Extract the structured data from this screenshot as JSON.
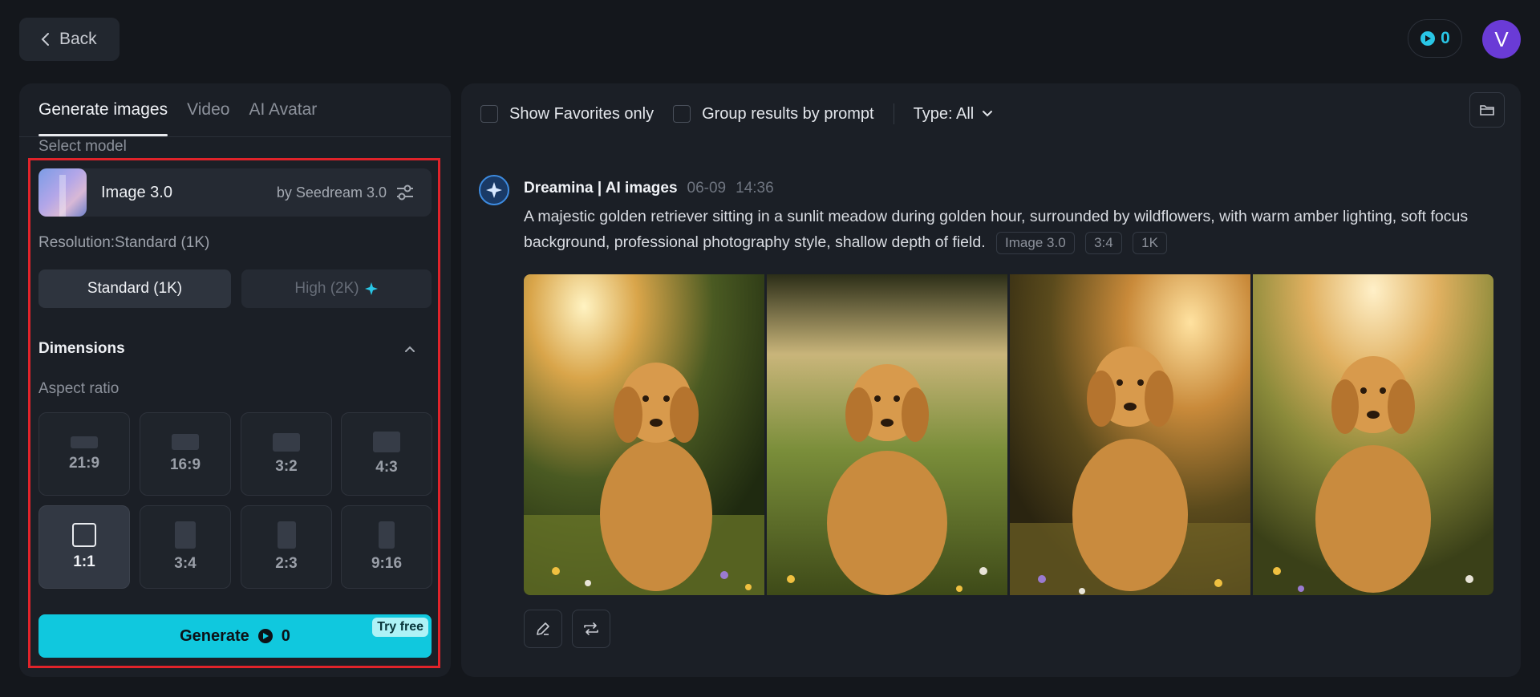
{
  "header": {
    "back_label": "Back",
    "credits": "0",
    "avatar_initial": "V"
  },
  "left": {
    "tabs": [
      {
        "label": "Generate images",
        "active": true
      },
      {
        "label": "Video",
        "active": false
      },
      {
        "label": "AI Avatar",
        "active": false
      }
    ],
    "select_model_label": "Select model",
    "model": {
      "name": "Image 3.0",
      "by": "by Seedream 3.0"
    },
    "resolution_label": "Resolution:Standard (1K)",
    "resolution_options": [
      {
        "label": "Standard (1K)",
        "selected": true
      },
      {
        "label": "High (2K)",
        "selected": false
      }
    ],
    "dimensions_title": "Dimensions",
    "aspect_label": "Aspect ratio",
    "ratios": [
      "21:9",
      "16:9",
      "3:2",
      "4:3",
      "1:1",
      "3:4",
      "2:3",
      "9:16"
    ],
    "selected_ratio": "1:1",
    "generate_label": "Generate",
    "generate_cost": "0",
    "try_free_label": "Try free"
  },
  "right": {
    "show_favorites_label": "Show Favorites only",
    "group_by_prompt_label": "Group results by prompt",
    "type_filter_label": "Type: All",
    "feed": {
      "source": "Dreamina | AI images",
      "date": "06-09",
      "time": "14:36",
      "prompt": "A majestic golden retriever sitting in a sunlit meadow during golden hour, surrounded by wildflowers, with warm amber lighting, soft focus background, professional photography style, shallow depth of field.",
      "tags": [
        "Image 3.0",
        "3:4",
        "1K"
      ]
    }
  },
  "colors": {
    "accent": "#10c8de",
    "background": "#14171c",
    "panel": "#1b1f26",
    "highlight_border": "#e0232a",
    "avatar": "#6a3bd6"
  },
  "icons": [
    "chevron-left-icon",
    "credit-coin-icon",
    "tune-icon",
    "sparkle-icon",
    "chevron-up-icon",
    "chevron-down-icon",
    "folder-icon",
    "dreamina-logo-icon",
    "edit-icon",
    "regenerate-icon"
  ]
}
